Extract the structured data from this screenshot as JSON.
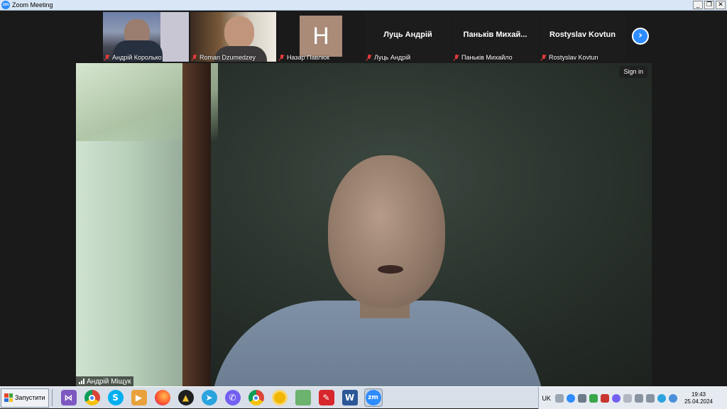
{
  "window": {
    "title": "Zoom Meeting",
    "app_icon_text": "zm",
    "min": "_",
    "restore": "❐",
    "close": "✕"
  },
  "participants": [
    {
      "name": "Андрій Королько",
      "type": "video"
    },
    {
      "name": "Roman Dzumedzey",
      "type": "video"
    },
    {
      "name": "Назар Павлюк",
      "type": "avatar",
      "initial": "H"
    },
    {
      "name": "Луць Андрій",
      "type": "name",
      "display": "Луць Андрій"
    },
    {
      "name": "Паньків Михайло",
      "type": "name",
      "display": "Паньків Михай..."
    },
    {
      "name": "Rostyslav Kovtun",
      "type": "name",
      "display": "Rostyslav Kovtun"
    }
  ],
  "next_button": "›",
  "main_video": {
    "speaker": "Андрій Міщук",
    "sign_in": "Sign in"
  },
  "taskbar": {
    "start_label": "Запустити",
    "apps": [
      "visual-studio",
      "chrome",
      "skype",
      "media-player",
      "firefox",
      "archive",
      "telegram",
      "viber",
      "chrome-profile",
      "yellow-app",
      "file-manager",
      "acrobat",
      "word",
      "zoom"
    ],
    "zoom_label": "zm",
    "lang": "UK",
    "time": "19:43",
    "date": "25.04.2024"
  }
}
